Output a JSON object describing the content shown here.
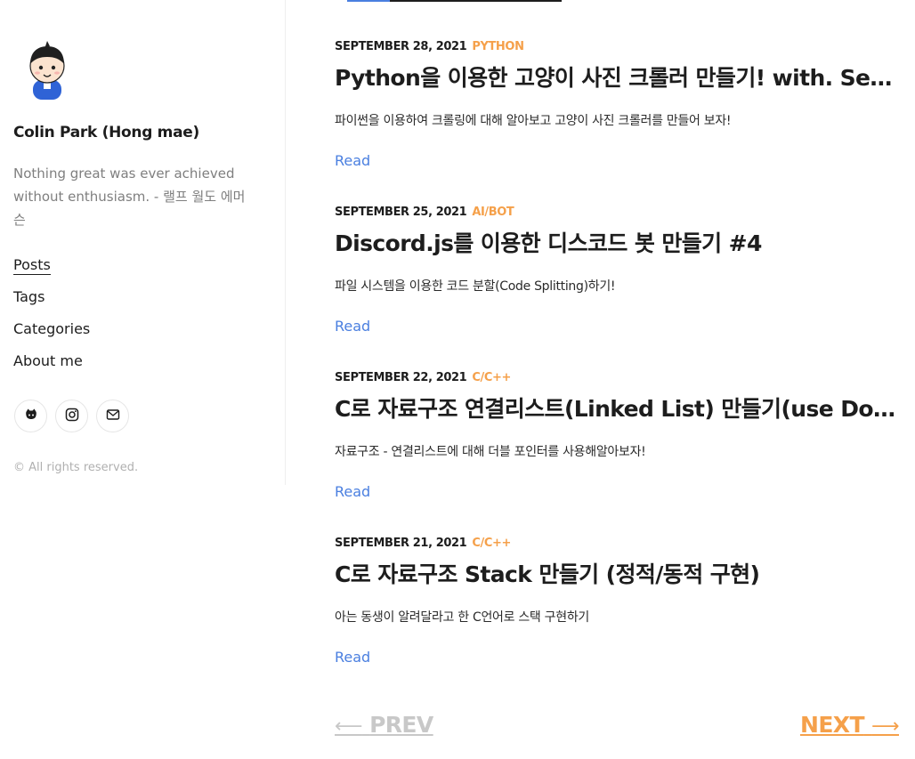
{
  "author": {
    "name": "Colin Park (Hong mae)",
    "tagline": "Nothing great was ever achieved without enthusiasm. - 랠프 월도 에머슨"
  },
  "nav": {
    "items": [
      {
        "label": "Posts",
        "active": true
      },
      {
        "label": "Tags",
        "active": false
      },
      {
        "label": "Categories",
        "active": false
      },
      {
        "label": "About me",
        "active": false
      }
    ]
  },
  "socials": [
    {
      "icon": "github-icon"
    },
    {
      "icon": "instagram-icon"
    },
    {
      "icon": "mail-icon"
    }
  ],
  "copyright": "© All rights reserved.",
  "posts": [
    {
      "date": "SEPTEMBER 28, 2021",
      "category": "PYTHON",
      "title": "Python을 이용한 고양이 사진 크롤러 만들기! with. Selenium",
      "excerpt": "파이썬을 이용하여 크롤링에 대해 알아보고 고양이 사진 크롤러를 만들어 보자!",
      "read_label": "Read"
    },
    {
      "date": "SEPTEMBER 25, 2021",
      "category": "AI/BOT",
      "title": "Discord.js를 이용한 디스코드 봇 만들기 #4",
      "excerpt": "파일 시스템을 이용한 코드 분할(Code Splitting)하기!",
      "read_label": "Read"
    },
    {
      "date": "SEPTEMBER 22, 2021",
      "category": "C/C++",
      "title": "C로 자료구조 연결리스트(Linked List) 만들기(use Double Pointer)",
      "excerpt": "자료구조 - 연결리스트에 대해 더블 포인터를 사용해알아보자!",
      "read_label": "Read"
    },
    {
      "date": "SEPTEMBER 21, 2021",
      "category": "C/C++",
      "title": "C로 자료구조 Stack 만들기 (정적/동적 구현)",
      "excerpt": "아는 동생이 알려달라고 한 C언어로 스택 구현하기",
      "read_label": "Read"
    }
  ],
  "pagination": {
    "prev_label": "PREV",
    "next_label": "NEXT",
    "prev_arrow": "⟵",
    "next_arrow": "⟶"
  },
  "colors": {
    "accent": "#f5a04a",
    "link": "#4a7fe0",
    "muted": "#7f7f7f"
  }
}
